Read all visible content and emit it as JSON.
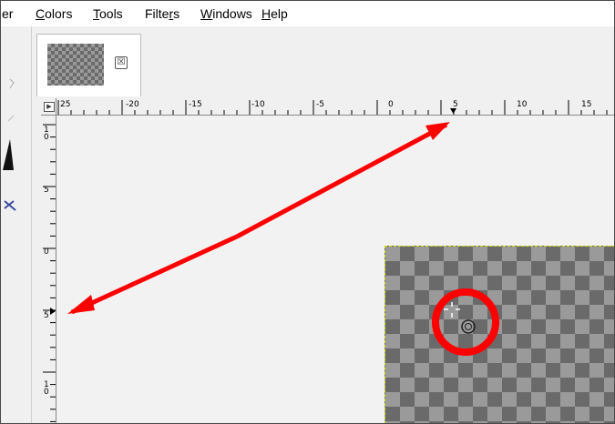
{
  "menubar": {
    "items": [
      {
        "label": "er",
        "mnemonic": ""
      },
      {
        "label": "Colors",
        "mnemonic": "C"
      },
      {
        "label": "Tools",
        "mnemonic": "T"
      },
      {
        "label": "Filters",
        "mnemonic": "r"
      },
      {
        "label": "Windows",
        "mnemonic": "W"
      },
      {
        "label": "Help",
        "mnemonic": "H"
      }
    ]
  },
  "image_tab": {
    "close_symbol": "☒"
  },
  "nav_button": {
    "symbol": "▶"
  },
  "rulers": {
    "horizontal": [
      "25",
      "-20",
      "-15",
      "-10",
      "-5",
      "0",
      "5",
      "10",
      "15"
    ],
    "vertical": [
      "1\n0",
      "5",
      "0",
      "5",
      "1\n0"
    ]
  },
  "annotations": {
    "arrow_color": "#ff0000",
    "circle_color": "#ff0000"
  },
  "colors": {
    "selection_border": "#d8d800",
    "checker_dark": "#6a6a6a",
    "checker_light": "#9a9a9a"
  }
}
